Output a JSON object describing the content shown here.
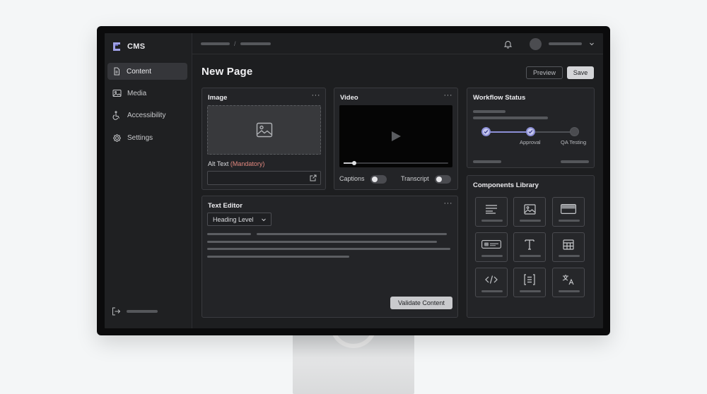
{
  "brand": {
    "name": "CMS"
  },
  "sidebar": {
    "items": [
      {
        "label": "Content",
        "icon": "document-icon",
        "active": true
      },
      {
        "label": "Media",
        "icon": "image-icon",
        "active": false
      },
      {
        "label": "Accessibility",
        "icon": "accessibility-icon",
        "active": false
      },
      {
        "label": "Settings",
        "icon": "gear-icon",
        "active": false
      }
    ],
    "logout_icon": "logout-icon"
  },
  "page": {
    "title": "New Page",
    "preview_label": "Preview",
    "save_label": "Save"
  },
  "image_card": {
    "title": "Image",
    "more": "···",
    "alt_label": "Alt Text",
    "alt_required": "(Mandatory)"
  },
  "video_card": {
    "title": "Video",
    "more": "···",
    "captions_label": "Captions",
    "transcript_label": "Transcript",
    "progress": 0.1
  },
  "text_editor": {
    "title": "Text Editor",
    "more": "···",
    "heading_select": "Heading Level",
    "validate_label": "Validate Content"
  },
  "workflow": {
    "title": "Workflow Status",
    "steps": [
      {
        "label": "",
        "state": "done"
      },
      {
        "label": "Approval",
        "state": "done"
      },
      {
        "label": "QA Testing",
        "state": "pending"
      }
    ]
  },
  "components_library": {
    "title": "Components Library",
    "items": [
      "text-block-icon",
      "image-icon",
      "card-icon",
      "button-icon",
      "typography-icon",
      "table-icon",
      "code-icon",
      "list-icon",
      "translate-icon"
    ]
  },
  "colors": {
    "accent": "#8c8fd6",
    "required": "#e2887f",
    "background": "#1d1e20"
  }
}
